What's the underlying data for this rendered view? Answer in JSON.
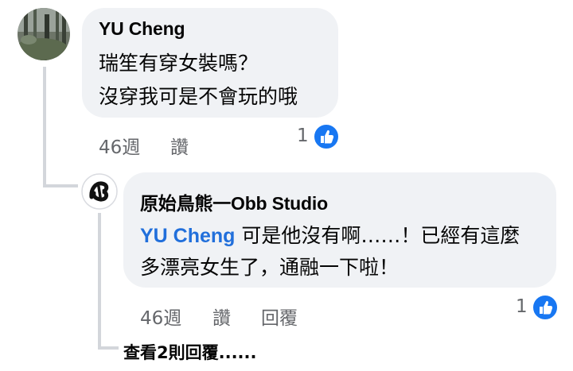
{
  "comment": {
    "author": "YU Cheng",
    "lines": [
      "瑞笙有穿女裝嗎？",
      "沒穿我可是不會玩的哦"
    ],
    "time": "46週",
    "like_label": "讚",
    "reaction_count": "1",
    "reaction_icon": "thumbs-up-icon"
  },
  "reply": {
    "author": "原始鳥熊一Obb Studio",
    "mention": "YU Cheng",
    "line1_rest": " 可是他沒有啊……！已經有這麼",
    "line2": "多漂亮女生了，通融一下啦！",
    "time": "46週",
    "like_label": "讚",
    "reply_label": "回覆",
    "reaction_count": "1",
    "reaction_icon": "thumbs-up-icon"
  },
  "view_more": "查看2則回覆......",
  "colors": {
    "bubble": "#f0f2f5",
    "mention": "#216fdb",
    "like_blue": "#1877f2",
    "meta_gray": "#65676b"
  }
}
